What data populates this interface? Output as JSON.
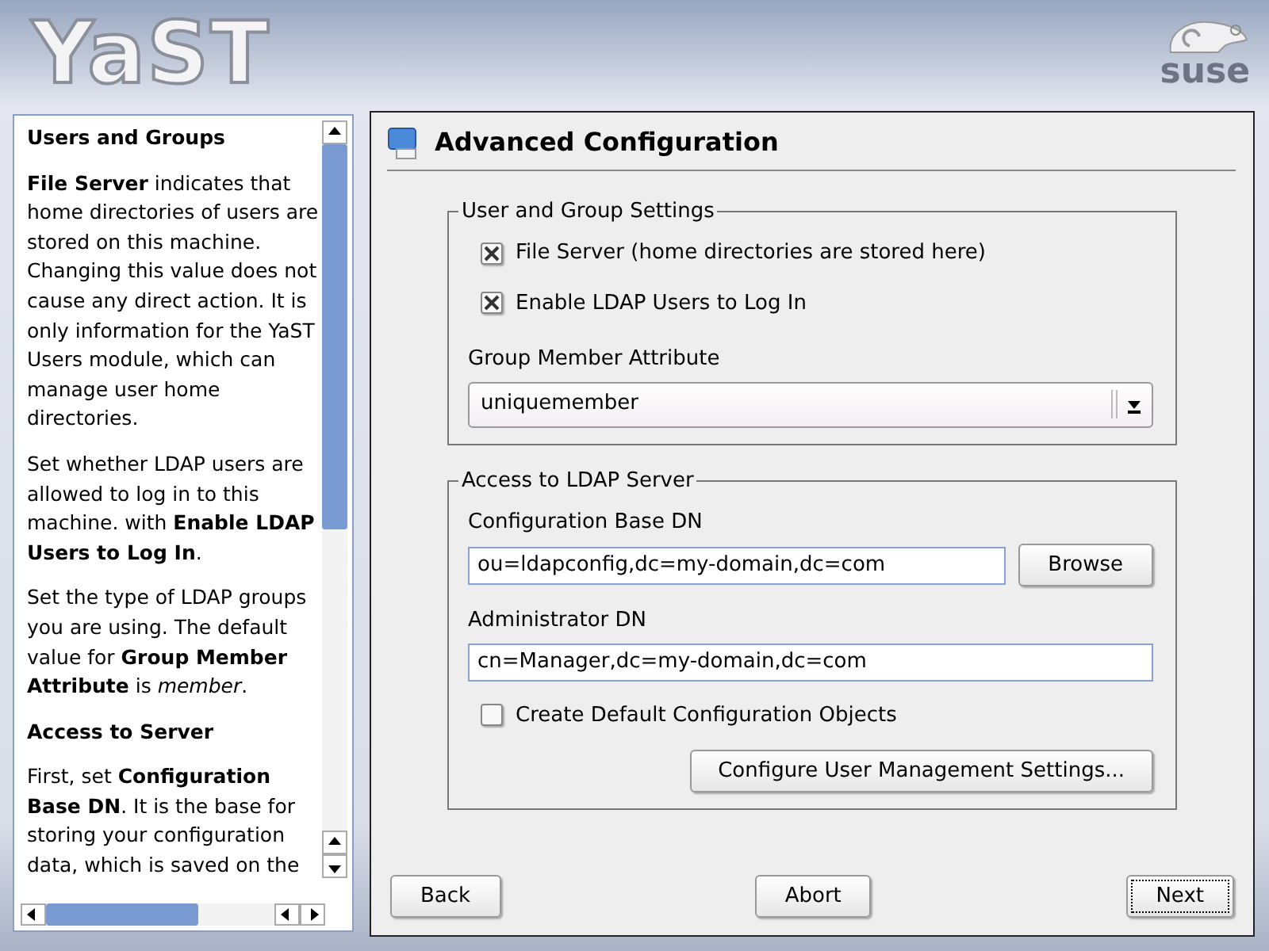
{
  "header": {
    "logo": "YaST",
    "brand": "suse"
  },
  "help": {
    "paragraphs": [
      {
        "kind": "heading",
        "text": "Users and Groups"
      },
      {
        "kind": "text",
        "text": "**File Server** indicates that home directories of users are stored on this machine. Changing this value does not cause any direct action. It is only information for the YaST Users module, which can manage user home directories."
      },
      {
        "kind": "text",
        "text": "Set whether LDAP users are allowed to log in to this machine. with **Enable LDAP Users to Log In**."
      },
      {
        "kind": "text",
        "text": "Set the type of LDAP groups you are using. The default value for **Group Member Attribute** is *member*."
      },
      {
        "kind": "heading",
        "text": "Access to Server"
      },
      {
        "kind": "text",
        "text": "First, set **Configuration Base DN**. It is the base for storing your configuration data, which is saved on the"
      }
    ]
  },
  "dialog": {
    "title": "Advanced Configuration",
    "groups": [
      {
        "title": "User and Group Settings",
        "items": [
          {
            "kind": "checkbox",
            "label": "File Server (home directories are stored here)",
            "checked": true
          },
          {
            "kind": "checkbox",
            "label": "Enable LDAP Users to Log In",
            "checked": true
          },
          {
            "kind": "combo",
            "label": "Group Member Attribute",
            "value": "uniquemember"
          }
        ]
      },
      {
        "title": "Access to LDAP Server",
        "items": [
          {
            "kind": "text",
            "label": "Configuration Base DN",
            "value": "ou=ldapconfig,dc=my-domain,dc=com",
            "button": "Browse"
          },
          {
            "kind": "text",
            "label": "Administrator DN",
            "value": "cn=Manager,dc=my-domain,dc=com"
          },
          {
            "kind": "checkbox",
            "label": "Create Default Configuration Objects",
            "checked": false
          },
          {
            "kind": "button",
            "label": "Configure User Management Settings..."
          }
        ]
      }
    ],
    "buttons": [
      {
        "label": "Back",
        "default": false
      },
      {
        "label": "Abort",
        "default": false
      },
      {
        "label": "Next",
        "default": true
      }
    ]
  }
}
